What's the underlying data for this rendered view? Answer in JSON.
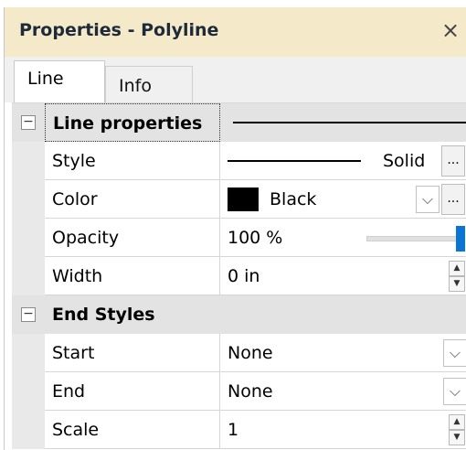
{
  "window": {
    "title": "Properties - Polyline"
  },
  "tabs": [
    {
      "label": "Line"
    },
    {
      "label": "Info"
    }
  ],
  "groups": {
    "line_properties": {
      "label": "Line properties",
      "style": {
        "label": "Style",
        "value": "Solid"
      },
      "color": {
        "label": "Color",
        "value": "Black",
        "swatch": "#000000"
      },
      "opacity": {
        "label": "Opacity",
        "value": "100 %",
        "level": 1.0
      },
      "width": {
        "label": "Width",
        "value": "0 in"
      }
    },
    "end_styles": {
      "label": "End Styles",
      "start": {
        "label": "Start",
        "value": "None"
      },
      "end": {
        "label": "End",
        "value": "None"
      },
      "scale": {
        "label": "Scale",
        "value": "1"
      }
    }
  },
  "colors": {
    "title_bar": "#f4e9c8",
    "slider_thumb": "#0a74d6"
  }
}
